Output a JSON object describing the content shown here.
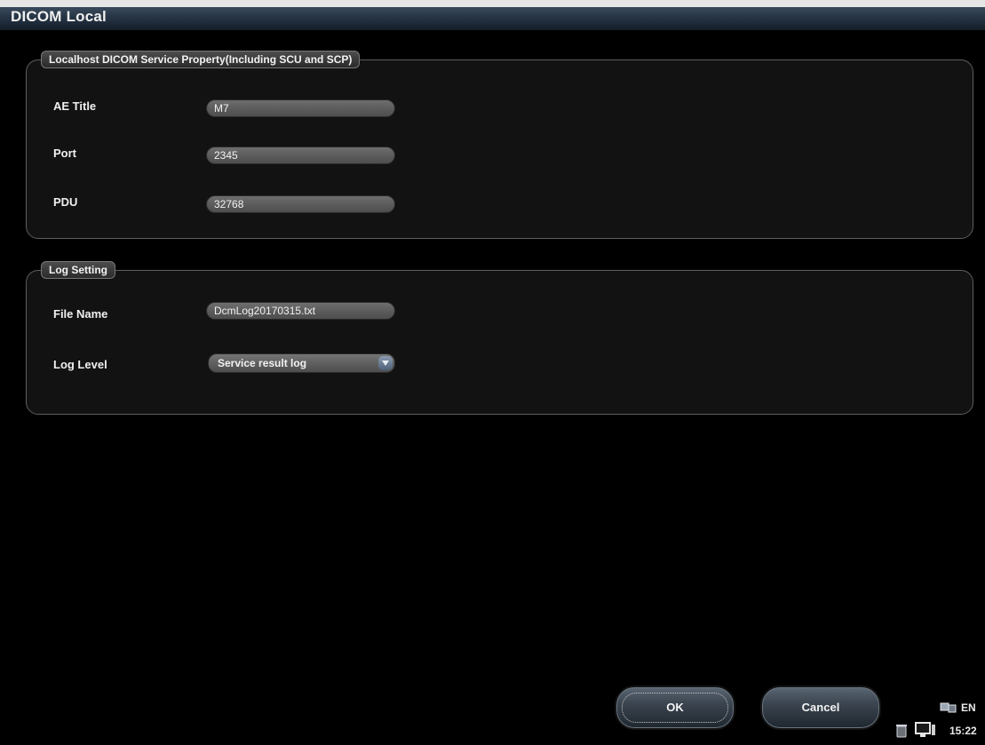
{
  "window": {
    "title": "DICOM Local"
  },
  "service_group": {
    "legend": "Localhost DICOM Service Property(Including SCU and SCP)",
    "fields": [
      {
        "label": "AE Title",
        "value": "M7"
      },
      {
        "label": "Port",
        "value": "2345"
      },
      {
        "label": "PDU",
        "value": "32768"
      }
    ]
  },
  "log_group": {
    "legend": "Log Setting",
    "file_name_label": "File Name",
    "file_name_value": "DcmLog20170315.txt",
    "log_level_label": "Log Level",
    "log_level_value": "Service result log"
  },
  "buttons": {
    "ok": "OK",
    "cancel": "Cancel"
  },
  "tray": {
    "language": "EN",
    "time": "15:22",
    "icons": [
      "network-icon",
      "trash-icon",
      "monitor-icon"
    ]
  },
  "colors": {
    "background": "#000000",
    "titlebar": "#253444",
    "accent": "#4e6078"
  }
}
